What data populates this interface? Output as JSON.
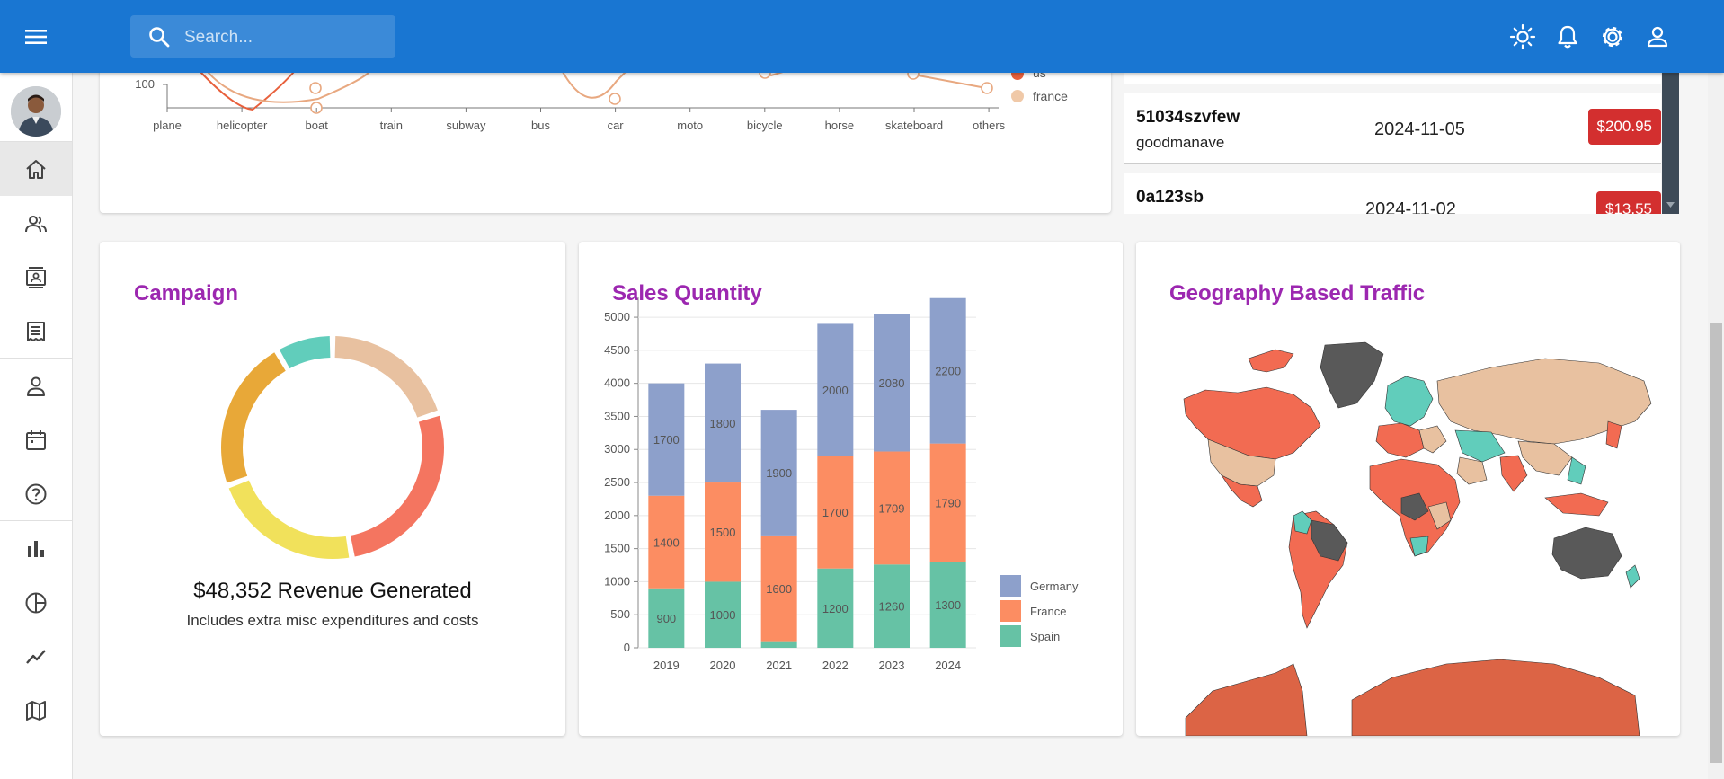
{
  "header": {
    "search_placeholder": "Search...",
    "icons": [
      "menu-icon",
      "search-icon",
      "light-mode-icon",
      "notifications-icon",
      "settings-icon",
      "person-icon"
    ]
  },
  "sidebar": {
    "items": [
      "home-icon",
      "team-icon",
      "contacts-icon",
      "invoices-icon",
      "profile-icon",
      "calendar-icon",
      "faq-icon",
      "bar-chart-icon",
      "pie-chart-icon",
      "line-chart-icon",
      "geography-icon"
    ]
  },
  "line_chart_fragment": {
    "y_tick": "100",
    "categories": [
      "plane",
      "helicopter",
      "boat",
      "train",
      "subway",
      "bus",
      "car",
      "moto",
      "bicycle",
      "horse",
      "skateboard",
      "others"
    ],
    "legend": [
      "us",
      "france"
    ]
  },
  "transactions": [
    {
      "txId": "51034szvfew",
      "user": "goodmanave",
      "date": "2024-11-05",
      "cost": "$200.95"
    },
    {
      "txId": "0a123sb",
      "user": "",
      "date": "2024-11-02",
      "cost": "$13.55"
    }
  ],
  "campaign": {
    "title": "Campaign",
    "revenue": "$48,352 Revenue Generated",
    "subtitle": "Includes extra misc expenditures and costs",
    "ring_colors": [
      "#e8c1a0",
      "#f47560",
      "#f1e15b",
      "#e8a838",
      "#61cdbb"
    ]
  },
  "sales": {
    "title": "Sales Quantity"
  },
  "geo": {
    "title": "Geography Based Traffic"
  },
  "chart_data": {
    "type": "bar",
    "stacked": true,
    "categories": [
      "2019",
      "2020",
      "2021",
      "2022",
      "2023",
      "2024"
    ],
    "series": [
      {
        "name": "Spain",
        "color": "#66c2a5",
        "values": [
          900,
          1000,
          100,
          1200,
          1260,
          1300
        ]
      },
      {
        "name": "France",
        "color": "#fc8d62",
        "values": [
          1400,
          1500,
          1600,
          1700,
          1709,
          1790
        ]
      },
      {
        "name": "Germany",
        "color": "#8da0cb",
        "values": [
          1700,
          1800,
          1900,
          2000,
          2080,
          2200
        ]
      }
    ],
    "labels": [
      [
        "900",
        "1000",
        "",
        "1200",
        "1260",
        "1300"
      ],
      [
        "1400",
        "1500",
        "1600",
        "1700",
        "1709",
        "1790"
      ],
      [
        "1700",
        "1800",
        "1900",
        "2000",
        "2080",
        "2200"
      ]
    ],
    "yticks": [
      "0",
      "500",
      "1000",
      "1500",
      "2000",
      "2500",
      "3000",
      "3500",
      "4000",
      "4500",
      "5000"
    ],
    "ylim": [
      0,
      5300
    ],
    "legend": [
      "Germany",
      "France",
      "Spain"
    ],
    "legend_position": "right",
    "grid": true
  }
}
